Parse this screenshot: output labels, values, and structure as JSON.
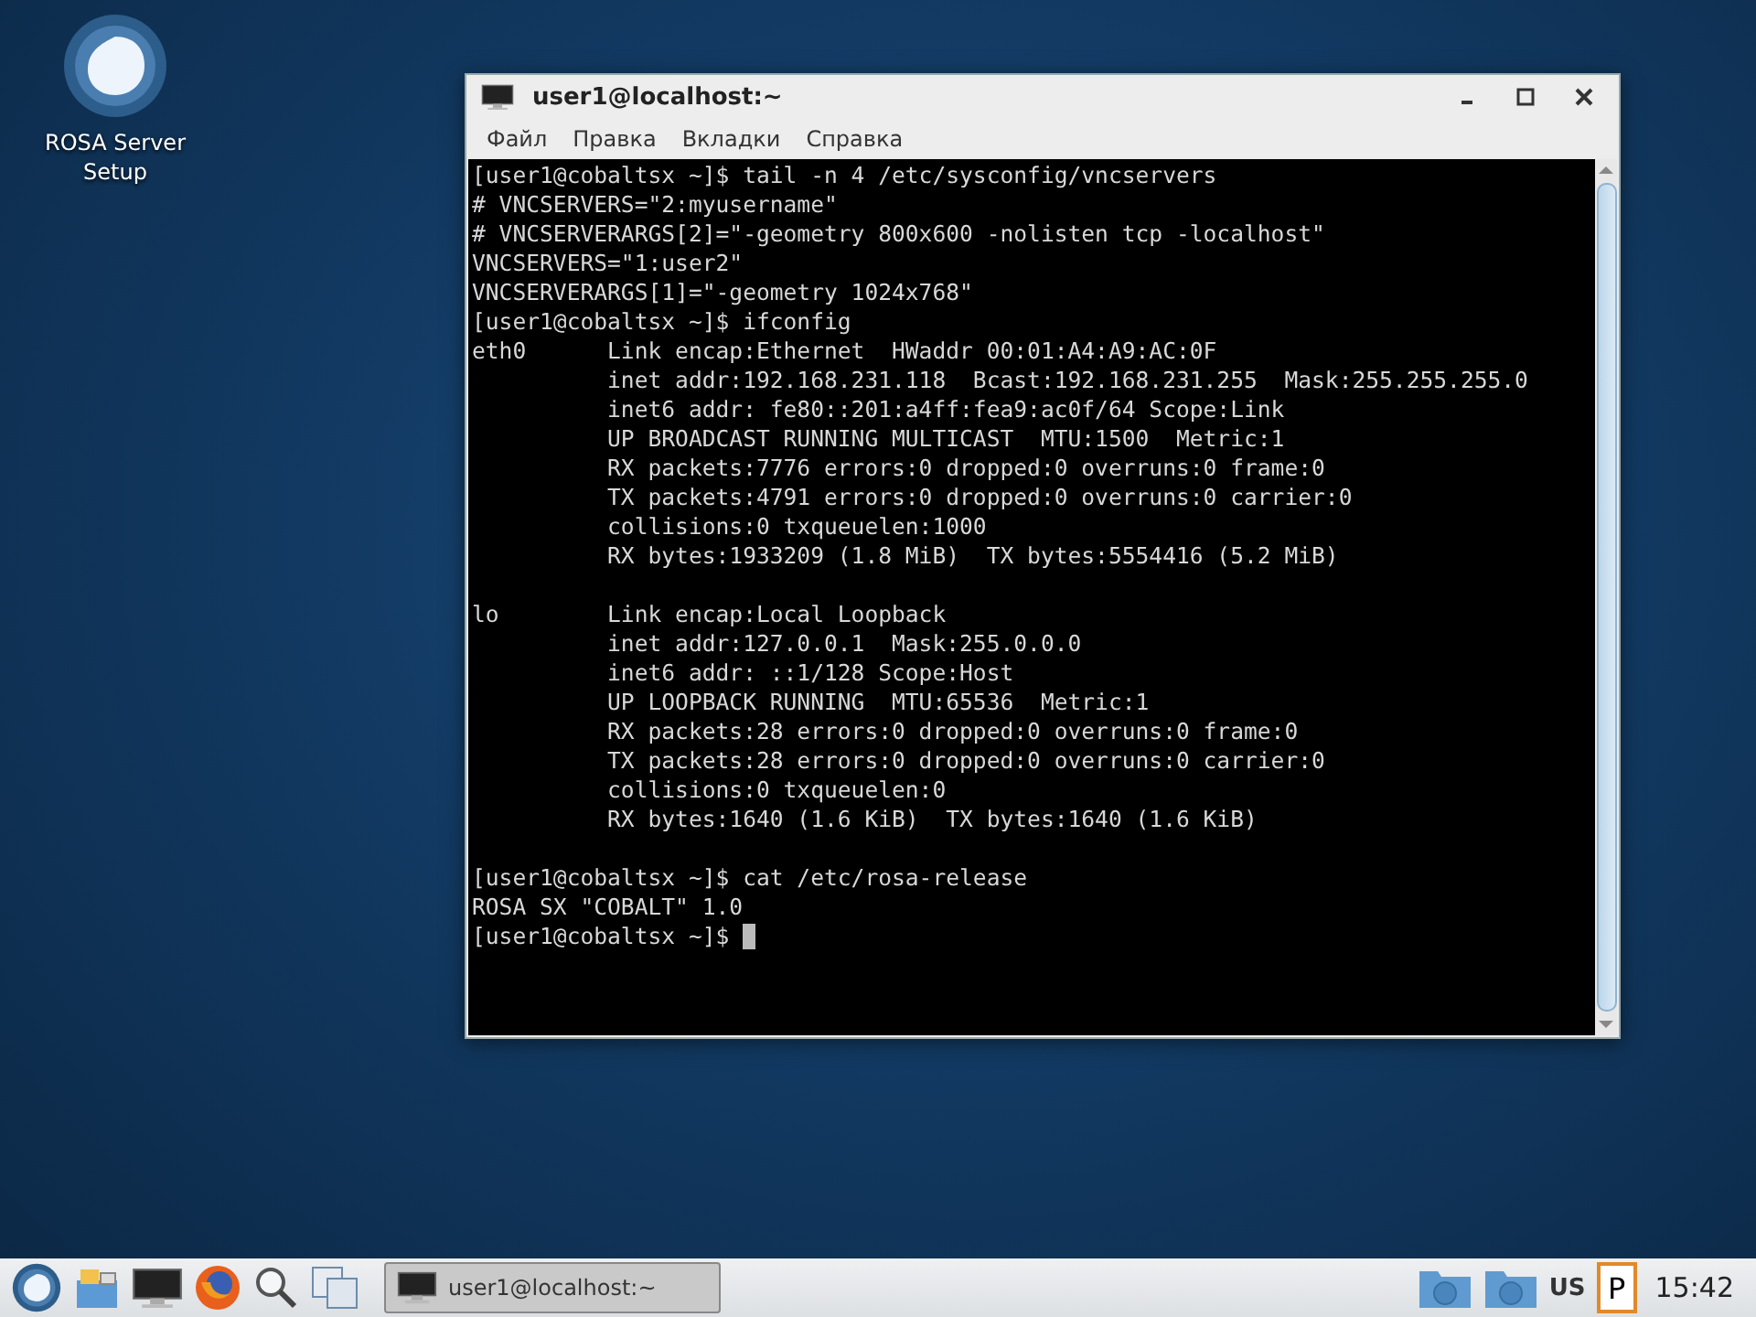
{
  "desktop_icons": [
    {
      "label": "ROSA Server Setup"
    }
  ],
  "window": {
    "title": "user1@localhost:~",
    "active": true
  },
  "menu": [
    "Файл",
    "Правка",
    "Вкладки",
    "Справка"
  ],
  "terminal": {
    "cursor": true,
    "lines": [
      {
        "kind": "text",
        "text": "[user1@cobaltsx ~]$ tail -n 4 /etc/sysconfig/vncservers"
      },
      {
        "kind": "text",
        "text": "# VNCSERVERS=\"2:myusername\""
      },
      {
        "kind": "text",
        "text": "# VNCSERVERARGS[2]=\"-geometry 800x600 -nolisten tcp -localhost\""
      },
      {
        "kind": "text",
        "text": "VNCSERVERS=\"1:user2\""
      },
      {
        "kind": "text",
        "text": "VNCSERVERARGS[1]=\"-geometry 1024x768\""
      },
      {
        "kind": "text",
        "text": "[user1@cobaltsx ~]$ ifconfig"
      },
      {
        "kind": "text",
        "text": "eth0      Link encap:Ethernet  HWaddr 00:01:A4:A9:AC:0F"
      },
      {
        "kind": "text",
        "text": "          inet addr:192.168.231.118  Bcast:192.168.231.255  Mask:255.255.255.0"
      },
      {
        "kind": "text",
        "text": "          inet6 addr: fe80::201:a4ff:fea9:ac0f/64 Scope:Link"
      },
      {
        "kind": "text",
        "text": "          UP BROADCAST RUNNING MULTICAST  MTU:1500  Metric:1"
      },
      {
        "kind": "text",
        "text": "          RX packets:7776 errors:0 dropped:0 overruns:0 frame:0"
      },
      {
        "kind": "text",
        "text": "          TX packets:4791 errors:0 dropped:0 overruns:0 carrier:0"
      },
      {
        "kind": "text",
        "text": "          collisions:0 txqueuelen:1000"
      },
      {
        "kind": "text",
        "text": "          RX bytes:1933209 (1.8 MiB)  TX bytes:5554416 (5.2 MiB)"
      },
      {
        "kind": "blank"
      },
      {
        "kind": "text",
        "text": "lo        Link encap:Local Loopback"
      },
      {
        "kind": "text",
        "text": "          inet addr:127.0.0.1  Mask:255.0.0.0"
      },
      {
        "kind": "text",
        "text": "          inet6 addr: ::1/128 Scope:Host"
      },
      {
        "kind": "text",
        "text": "          UP LOOPBACK RUNNING  MTU:65536  Metric:1"
      },
      {
        "kind": "text",
        "text": "          RX packets:28 errors:0 dropped:0 overruns:0 frame:0"
      },
      {
        "kind": "text",
        "text": "          TX packets:28 errors:0 dropped:0 overruns:0 carrier:0"
      },
      {
        "kind": "text",
        "text": "          collisions:0 txqueuelen:0"
      },
      {
        "kind": "text",
        "text": "          RX bytes:1640 (1.6 KiB)  TX bytes:1640 (1.6 KiB)"
      },
      {
        "kind": "blank"
      },
      {
        "kind": "text",
        "text": "[user1@cobaltsx ~]$ cat /etc/rosa-release"
      },
      {
        "kind": "text",
        "text": "ROSA SX \"COBALT\" 1.0"
      },
      {
        "kind": "text",
        "text": "[user1@cobaltsx ~]$"
      }
    ]
  },
  "taskbar": {
    "tasks": [
      {
        "label": "user1@localhost:~",
        "selected": true
      }
    ],
    "keyboard_layout": "US",
    "clipboard_letter": "P",
    "clock": "15:42"
  }
}
